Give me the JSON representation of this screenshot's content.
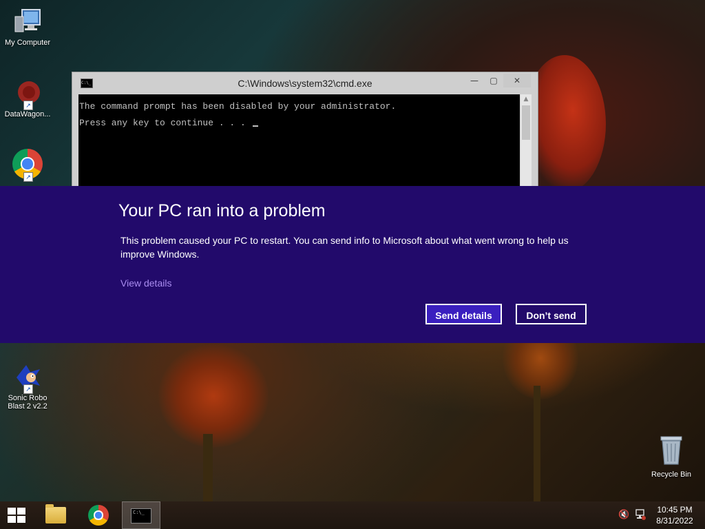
{
  "desktop": {
    "icons": [
      {
        "label": "My Computer",
        "icon": "computer-icon"
      },
      {
        "label": "DataWagon...",
        "icon": "datawagon-icon"
      },
      {
        "label": "Google Chrome",
        "icon": "chrome-icon"
      },
      {
        "label": "Sonic Robo Blast 2 v2.2",
        "icon": "sonic-icon"
      },
      {
        "label": "Recycle Bin",
        "icon": "recycle-bin-icon"
      }
    ]
  },
  "cmd_window": {
    "title": "C:\\Windows\\system32\\cmd.exe",
    "lines": [
      "The command prompt has been disabled by your administrator.",
      "Press any key to continue . . . "
    ],
    "buttons": {
      "minimize": "—",
      "maximize": "▢",
      "close": "✕"
    }
  },
  "error_dialog": {
    "title": "Your PC ran into a problem",
    "body": "This problem caused your PC to restart. You can send info to Microsoft about what went wrong to help us improve Windows.",
    "view_details": "View details",
    "send_button": "Send details",
    "dont_send_button": "Don’t send",
    "colors": {
      "background": "#220a6b",
      "primary_button": "#3a1fbf",
      "link": "#a98cf0"
    }
  },
  "taskbar": {
    "pinned": [
      "start-icon",
      "file-explorer-icon",
      "chrome-icon",
      "cmd-icon"
    ],
    "tray": {
      "volume": "🔇",
      "network": "network-icon"
    },
    "clock": {
      "time": "10:45 PM",
      "date": "8/31/2022"
    }
  }
}
